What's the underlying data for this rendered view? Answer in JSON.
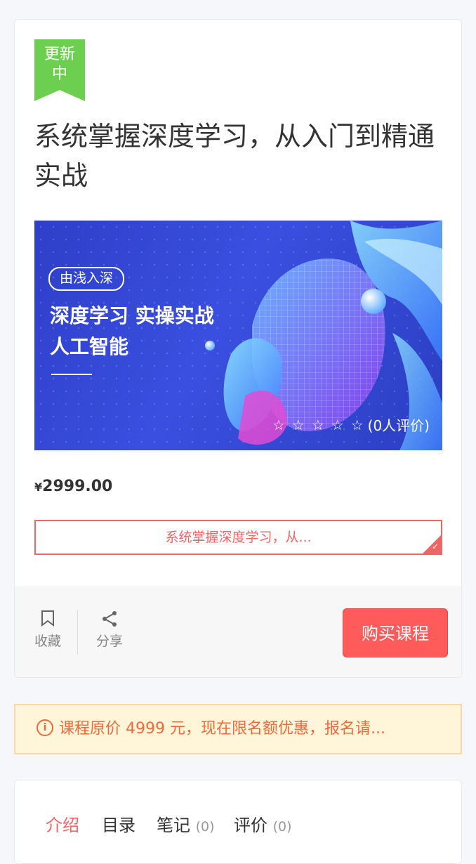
{
  "course": {
    "ribbon": "更新中",
    "title": "系统掌握深度学习，从入门到精通实战",
    "banner": {
      "tag": "由浅入深",
      "headline1": "深度学习 实操实战",
      "headline2": "人工智能",
      "rating_text": "(0人评价)",
      "stars": 5
    },
    "currency": "¥",
    "price": "2999.00",
    "coupon_text": "系统掌握深度学习，从..."
  },
  "actions": {
    "favorite_label": "收藏",
    "share_label": "分享",
    "buy_label": "购买课程"
  },
  "notice": {
    "text": "课程原价 4999 元，现在限名额优惠，报名请..."
  },
  "tabs": [
    {
      "label": "介绍",
      "count": ""
    },
    {
      "label": "目录",
      "count": ""
    },
    {
      "label": "笔记",
      "count": "(0)"
    },
    {
      "label": "评价",
      "count": "(0)"
    }
  ],
  "colors": {
    "accent": "#f06666",
    "buy_button": "#ff5b5b",
    "ribbon": "#6ccf4f",
    "notice_text": "#f06a3b"
  }
}
